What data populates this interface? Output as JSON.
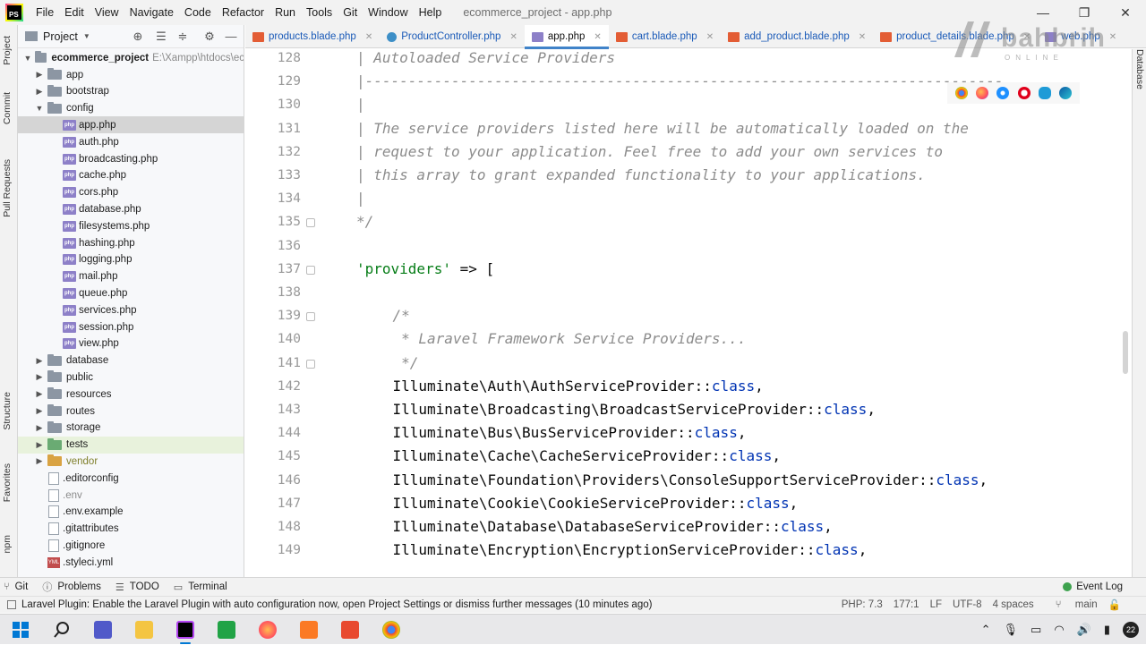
{
  "menubar": {
    "logo": "PS",
    "items": [
      "File",
      "Edit",
      "View",
      "Navigate",
      "Code",
      "Refactor",
      "Run",
      "Tools",
      "Git",
      "Window",
      "Help"
    ],
    "title": "ecommerce_project - app.php"
  },
  "left_strip": {
    "tabs": [
      "Project",
      "Commit",
      "Pull Requests",
      "Structure",
      "Favorites",
      "npm"
    ]
  },
  "project_panel": {
    "title": "Project",
    "root_name": "ecommerce_project",
    "root_path": "E:\\Xampp\\htdocs\\ec",
    "tree": [
      {
        "label": "app",
        "type": "folder",
        "depth": 1,
        "arrow": "▶"
      },
      {
        "label": "bootstrap",
        "type": "folder",
        "depth": 1,
        "arrow": "▶"
      },
      {
        "label": "config",
        "type": "folder",
        "depth": 1,
        "arrow": "▼"
      },
      {
        "label": "app.php",
        "type": "php",
        "depth": 2,
        "selected": true
      },
      {
        "label": "auth.php",
        "type": "php",
        "depth": 2
      },
      {
        "label": "broadcasting.php",
        "type": "php",
        "depth": 2
      },
      {
        "label": "cache.php",
        "type": "php",
        "depth": 2
      },
      {
        "label": "cors.php",
        "type": "php",
        "depth": 2
      },
      {
        "label": "database.php",
        "type": "php",
        "depth": 2
      },
      {
        "label": "filesystems.php",
        "type": "php",
        "depth": 2
      },
      {
        "label": "hashing.php",
        "type": "php",
        "depth": 2
      },
      {
        "label": "logging.php",
        "type": "php",
        "depth": 2
      },
      {
        "label": "mail.php",
        "type": "php",
        "depth": 2
      },
      {
        "label": "queue.php",
        "type": "php",
        "depth": 2
      },
      {
        "label": "services.php",
        "type": "php",
        "depth": 2
      },
      {
        "label": "session.php",
        "type": "php",
        "depth": 2
      },
      {
        "label": "view.php",
        "type": "php",
        "depth": 2
      },
      {
        "label": "database",
        "type": "folder",
        "depth": 1,
        "arrow": "▶"
      },
      {
        "label": "public",
        "type": "folder",
        "depth": 1,
        "arrow": "▶"
      },
      {
        "label": "resources",
        "type": "folder",
        "depth": 1,
        "arrow": "▶"
      },
      {
        "label": "routes",
        "type": "folder",
        "depth": 1,
        "arrow": "▶"
      },
      {
        "label": "storage",
        "type": "folder",
        "depth": 1,
        "arrow": "▶"
      },
      {
        "label": "tests",
        "type": "folder-green",
        "depth": 1,
        "arrow": "▶",
        "highlight": true
      },
      {
        "label": "vendor",
        "type": "folder-excl",
        "depth": 1,
        "arrow": "▶",
        "olive": true
      },
      {
        "label": ".editorconfig",
        "type": "file",
        "depth": 1
      },
      {
        "label": ".env",
        "type": "file",
        "depth": 1,
        "muted": true
      },
      {
        "label": ".env.example",
        "type": "file",
        "depth": 1
      },
      {
        "label": ".gitattributes",
        "type": "file",
        "depth": 1
      },
      {
        "label": ".gitignore",
        "type": "file",
        "depth": 1
      },
      {
        "label": ".styleci.yml",
        "type": "yml",
        "depth": 1
      }
    ]
  },
  "tabs": [
    {
      "label": "products.blade.php",
      "icon": "blade"
    },
    {
      "label": "ProductController.php",
      "icon": "class"
    },
    {
      "label": "app.php",
      "icon": "php",
      "active": true
    },
    {
      "label": "cart.blade.php",
      "icon": "blade"
    },
    {
      "label": "add_product.blade.php",
      "icon": "blade"
    },
    {
      "label": "product_details.blade.php",
      "icon": "blade"
    },
    {
      "label": "web.php",
      "icon": "php"
    }
  ],
  "editor": {
    "lines": [
      {
        "n": "128",
        "text": "| Autoloaded Service Providers",
        "style": "cm",
        "indent": 0
      },
      {
        "n": "129",
        "text": "|--------------------------------------------------------------------------",
        "style": "cm",
        "indent": 0
      },
      {
        "n": "130",
        "text": "|",
        "style": "cm",
        "indent": 0
      },
      {
        "n": "131",
        "text": "| The service providers listed here will be automatically loaded on the",
        "style": "cm",
        "indent": 0
      },
      {
        "n": "132",
        "text": "| request to your application. Feel free to add your own services to",
        "style": "cm",
        "indent": 0
      },
      {
        "n": "133",
        "text": "| this array to grant expanded functionality to your applications.",
        "style": "cm",
        "indent": 0
      },
      {
        "n": "134",
        "text": "|",
        "style": "cm",
        "indent": 0
      },
      {
        "n": "135",
        "text": "*/",
        "style": "cm",
        "indent": 0
      },
      {
        "n": "136",
        "text": "",
        "style": "",
        "indent": 0
      },
      {
        "n": "137",
        "text": "",
        "style": "providers",
        "indent": 0,
        "str": "'providers'",
        "rest": " => ["
      },
      {
        "n": "138",
        "text": "",
        "style": "",
        "indent": 0
      },
      {
        "n": "139",
        "text": "/*",
        "style": "cm",
        "indent": 5
      },
      {
        "n": "140",
        "text": " * Laravel Framework Service Providers...",
        "style": "cm",
        "indent": 5
      },
      {
        "n": "141",
        "text": " */",
        "style": "cm",
        "indent": 5
      },
      {
        "n": "142",
        "text": "Illuminate\\Auth\\AuthServiceProvider::",
        "style": "cls",
        "indent": 5
      },
      {
        "n": "143",
        "text": "Illuminate\\Broadcasting\\BroadcastServiceProvider::",
        "style": "cls",
        "indent": 5
      },
      {
        "n": "144",
        "text": "Illuminate\\Bus\\BusServiceProvider::",
        "style": "cls",
        "indent": 5
      },
      {
        "n": "145",
        "text": "Illuminate\\Cache\\CacheServiceProvider::",
        "style": "cls",
        "indent": 5
      },
      {
        "n": "146",
        "text": "Illuminate\\Foundation\\Providers\\ConsoleSupportServiceProvider::",
        "style": "cls",
        "indent": 5
      },
      {
        "n": "147",
        "text": "Illuminate\\Cookie\\CookieServiceProvider::",
        "style": "cls",
        "indent": 5
      },
      {
        "n": "148",
        "text": "Illuminate\\Database\\DatabaseServiceProvider::",
        "style": "cls",
        "indent": 5
      },
      {
        "n": "149",
        "text": "Illuminate\\Encryption\\EncryptionServiceProvider::",
        "style": "cls",
        "indent": 5
      }
    ],
    "class_kw": "class"
  },
  "watermark": {
    "text": "bahbrih",
    "sub": "ONLINE"
  },
  "right_strip": {
    "label": "Database"
  },
  "toolwindows": {
    "items": [
      "Git",
      "Problems",
      "TODO",
      "Terminal"
    ],
    "event_log": "Event Log"
  },
  "status": {
    "message": "Laravel Plugin: Enable the Laravel Plugin with auto configuration now, open Project Settings or dismiss further messages (10 minutes ago)",
    "php": "PHP: 7.3",
    "position": "177:1",
    "line_sep": "LF",
    "encoding": "UTF-8",
    "indent": "4 spaces",
    "branch": "main"
  },
  "taskbar": {
    "tray_notif": "22"
  },
  "colors": {
    "accent": "#4083c9",
    "comment": "#8c8c8c",
    "string": "#067d17",
    "keyword": "#0033b3"
  }
}
